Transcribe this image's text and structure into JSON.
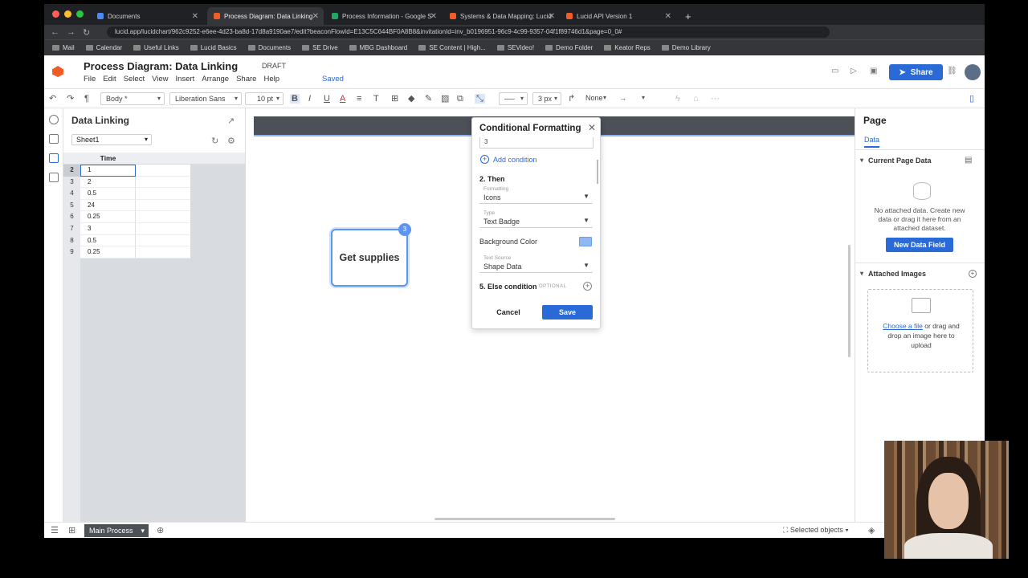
{
  "browser": {
    "tabs": [
      {
        "title": "Documents",
        "active": false
      },
      {
        "title": "Process Diagram: Data Linking",
        "active": true
      },
      {
        "title": "Process Information - Google S",
        "active": false
      },
      {
        "title": "Systems & Data Mapping: Lucid",
        "active": false
      },
      {
        "title": "Lucid API Version 1",
        "active": false
      }
    ],
    "url": "lucid.app/lucidchart/962c9252-e6ee-4d23-ba8d-17d8a9190ae7/edit?beaconFlowId=E13C5C644BF0A8B8&invitationId=inv_b0196951-96c9-4c99-9357-04f1f89746d1&page=0_0#",
    "bookmarks": [
      "Mail",
      "Calendar",
      "Useful Links",
      "Lucid Basics",
      "Documents",
      "SE Drive",
      "MBG Dashboard",
      "SE Content | High...",
      "SEVideo!",
      "Demo Folder",
      "Keator Reps",
      "Demo Library"
    ]
  },
  "header": {
    "doc_title": "Process Diagram: Data Linking",
    "status": "DRAFT",
    "menus": [
      "File",
      "Edit",
      "Select",
      "View",
      "Insert",
      "Arrange",
      "Share",
      "Help"
    ],
    "saved": "Saved",
    "share_label": "Share"
  },
  "toolbar": {
    "style": "Body *",
    "font": "Liberation Sans",
    "size": "10 pt",
    "line_width": "3 px",
    "arrow_start": "None"
  },
  "data_panel": {
    "title": "Data Linking",
    "sheet": "Sheet1",
    "column_header": "Time",
    "rows": [
      {
        "n": "2",
        "v": "1"
      },
      {
        "n": "3",
        "v": "2"
      },
      {
        "n": "4",
        "v": "0.5"
      },
      {
        "n": "5",
        "v": "24"
      },
      {
        "n": "6",
        "v": "0.25"
      },
      {
        "n": "7",
        "v": "3"
      },
      {
        "n": "8",
        "v": "0.5"
      },
      {
        "n": "9",
        "v": "0.25"
      }
    ]
  },
  "canvas": {
    "shape_label": "Get supplies",
    "shape_badge": "3"
  },
  "conditional_formatting": {
    "title": "Conditional Formatting",
    "condition_value": "3",
    "add_condition": "Add condition",
    "then_label": "2. Then",
    "formatting": {
      "label": "Formatting",
      "value": "Icons"
    },
    "type": {
      "label": "Type",
      "value": "Text Badge"
    },
    "background_color_label": "Background Color",
    "background_color": "#8fb8f5",
    "text_source": {
      "label": "Text Source",
      "value": "Shape Data"
    },
    "else_label": "5. Else condition",
    "optional": "OPTIONAL",
    "cancel": "Cancel",
    "save": "Save"
  },
  "right_panel": {
    "title": "Page",
    "tab": "Data",
    "current_section": "Current Page Data",
    "no_data_text": "No attached data. Create new data or drag it here from an attached dataset.",
    "new_field_button": "New Data Field",
    "images_section": "Attached Images",
    "choose_file": "Choose a file",
    "drop_text": "or drag and drop an image here to upload"
  },
  "bottom": {
    "page_tab": "Main Process",
    "selected_objects": "Selected objects"
  },
  "colors": {
    "accent": "#2a6ad6",
    "shape_border": "#5c96f0",
    "canvas_bar": "#4c5057"
  }
}
